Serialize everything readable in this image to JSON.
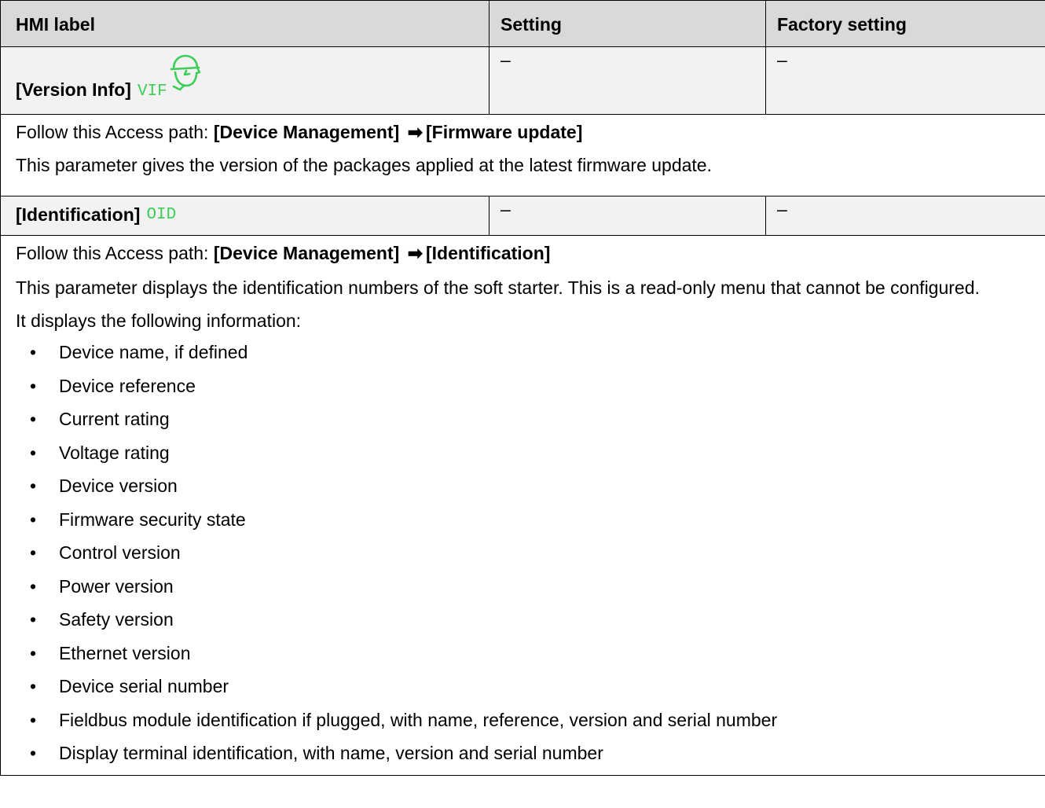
{
  "table": {
    "headers": {
      "hmi_label": "HMI label",
      "setting": "Setting",
      "factory_setting": "Factory setting"
    }
  },
  "version_info": {
    "label": "[Version Info]",
    "code": "VIF",
    "setting": "–",
    "factory": "–",
    "path_prefix": "Follow this Access path:",
    "path_from": "[Device Management]",
    "path_arrow": "➡",
    "path_to": "[Firmware update]",
    "description": "This parameter gives the version of the packages applied at the latest firmware update."
  },
  "identification": {
    "label": "[Identification]",
    "code": "OID",
    "setting": "–",
    "factory": "–",
    "path_prefix": "Follow this Access path:",
    "path_from": "[Device Management]",
    "path_arrow": "➡",
    "path_to": "[Identification]",
    "description": "This parameter displays the identification numbers of the soft starter. This is a read-only menu that cannot be configured.",
    "intro": "It displays the following information:",
    "bullet": "•",
    "items": [
      "Device name, if defined",
      "Device reference",
      "Current rating",
      "Voltage rating",
      "Device version",
      "Firmware security state",
      "Control version",
      "Power version",
      "Safety version",
      "Ethernet version",
      "Device serial number",
      "Fieldbus module identification if plugged, with name, reference, version and serial number",
      "Display terminal identification, with name, version and serial number"
    ]
  },
  "colors": {
    "code": "#3dcd58",
    "header_bg": "#d9d9d9",
    "row_bg": "#f2f2f2"
  },
  "icons": {
    "expert": "expert-helmet-icon"
  }
}
